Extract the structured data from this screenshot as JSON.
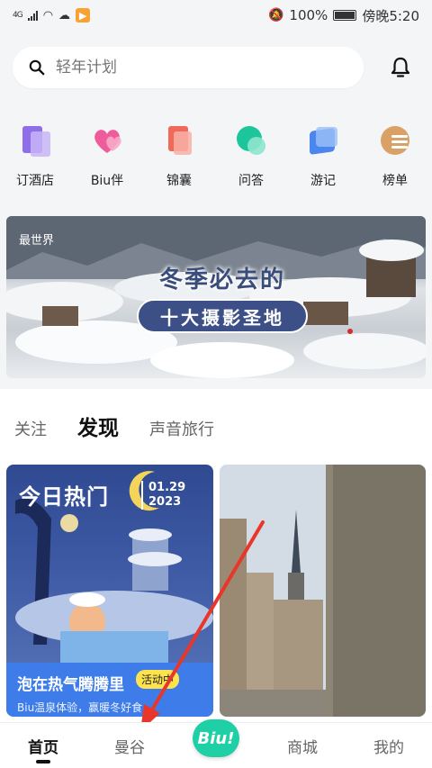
{
  "status_bar": {
    "network": "4G",
    "battery": "100%",
    "time": "傍晚5:20"
  },
  "search": {
    "placeholder": "轻年计划"
  },
  "quick_nav": [
    {
      "label": "订酒店",
      "icon": "hotel-icon",
      "color": "#9b7cf0"
    },
    {
      "label": "Biu伴",
      "icon": "heart-icon",
      "color": "#f06aa6"
    },
    {
      "label": "锦囊",
      "icon": "bag-icon",
      "color": "#f06a5a"
    },
    {
      "label": "问答",
      "icon": "chat-icon",
      "color": "#22c9a0"
    },
    {
      "label": "游记",
      "icon": "notes-icon",
      "color": "#4d8cf0"
    },
    {
      "label": "榜单",
      "icon": "ranking-icon",
      "color": "#d8a46a"
    }
  ],
  "banner": {
    "logo": "最世界",
    "title_line1": "冬季必去的",
    "title_line2": "十大摄影圣地"
  },
  "feed_tabs": [
    {
      "label": "关注",
      "active": false
    },
    {
      "label": "发现",
      "active": true
    },
    {
      "label": "声音旅行",
      "active": false
    }
  ],
  "cards": {
    "left": {
      "header": "今日热门",
      "date_line1": "01.29",
      "date_line2": "2023",
      "caption": "泡在热气腾腾里",
      "badge": "活动中",
      "subtitle": "Biu温泉体验，赢暖冬好食"
    }
  },
  "bottom_nav": [
    {
      "label": "首页",
      "active": true
    },
    {
      "label": "曼谷",
      "active": false
    },
    {
      "label": "Biu!",
      "center": true
    },
    {
      "label": "商城",
      "active": false
    },
    {
      "label": "我的",
      "active": false
    }
  ],
  "colors": {
    "accent": "#1fcfa6",
    "annotation_arrow": "#e8372a"
  }
}
